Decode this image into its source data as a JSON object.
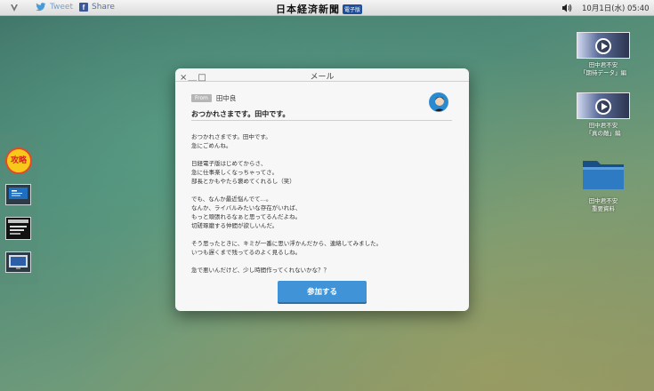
{
  "menubar": {
    "tweet_label": "Tweet",
    "share_label": "Share",
    "brand": "日本経済新聞",
    "brand_badge": "電子版",
    "clock": "10月1日(水) 05:40",
    "icons": [
      "logo-icon",
      "twitter-bird-icon",
      "facebook-icon",
      "speaker-icon"
    ]
  },
  "dock": {
    "badge_label": "攻略",
    "items": [
      "app-thumbnail-1",
      "app-thumbnail-2",
      "app-thumbnail-3"
    ]
  },
  "desktop": {
    "items": [
      {
        "label_line1": "田中君不安",
        "label_line2": "「期待データ」編",
        "icon": "video-thumbnail-icon"
      },
      {
        "label_line1": "田中君不安",
        "label_line2": "「真の敵」編",
        "icon": "video-thumbnail-icon"
      },
      {
        "label_line1": "田中君不安",
        "label_line2": "重要資料",
        "icon": "folder-icon"
      }
    ]
  },
  "window": {
    "title": "メール",
    "controls": "×＿□",
    "from_tag": "From",
    "from_name": "田中良",
    "subject": "おつかれさまです。田中です。",
    "body": [
      "おつかれさまです。田中です。",
      "急にごめんね。",
      "",
      "日経電子版はじめてからさ、",
      "急に仕事楽しくなっちゃってさ。",
      "部長とかもやたら褒めてくれるし（笑）",
      "",
      "でも、なんか最近悩んでて…。",
      "なんか、ライバルみたいな存在がいれば、",
      "もっと頑張れるなぁと思ってるんだよね。",
      "切磋琢磨する仲間が欲しいんだ。",
      "",
      "そう思ったときに、キミが一番に思い浮かんだから、連絡してみました。",
      "いつも遅くまで残ってるのよく見るしね。",
      "",
      "急で悪いんだけど、少し時間作ってくれないかな？？"
    ],
    "join_button": "参加する",
    "accent_color": "#3f93d6"
  }
}
